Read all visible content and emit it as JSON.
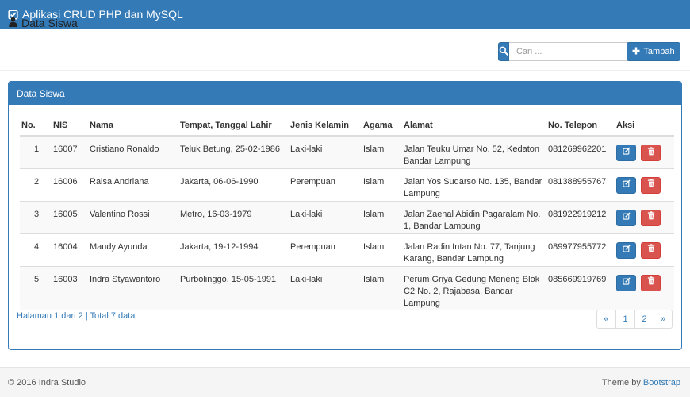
{
  "app": {
    "title": "Aplikasi CRUD PHP dan MySQL"
  },
  "header": {
    "title": "Data Siswa",
    "search_placeholder": "Cari ...",
    "add_label": "Tambah"
  },
  "panel": {
    "title": "Data Siswa"
  },
  "table": {
    "columns": [
      "No.",
      "NIS",
      "Nama",
      "Tempat, Tanggal Lahir",
      "Jenis Kelamin",
      "Agama",
      "Alamat",
      "No. Telepon",
      "Aksi"
    ],
    "rows": [
      {
        "no": "1",
        "nis": "16007",
        "nama": "Cristiano Ronaldo",
        "ttl": "Teluk Betung, 25-02-1986",
        "jk": "Laki-laki",
        "agama": "Islam",
        "alamat": "Jalan Teuku Umar No. 52, Kedaton Bandar Lampung",
        "telepon": "081269962201"
      },
      {
        "no": "2",
        "nis": "16006",
        "nama": "Raisa Andriana",
        "ttl": "Jakarta, 06-06-1990",
        "jk": "Perempuan",
        "agama": "Islam",
        "alamat": "Jalan Yos Sudarso No. 135, Bandar Lampung",
        "telepon": "081388955767"
      },
      {
        "no": "3",
        "nis": "16005",
        "nama": "Valentino Rossi",
        "ttl": "Metro, 16-03-1979",
        "jk": "Laki-laki",
        "agama": "Islam",
        "alamat": "Jalan Zaenal Abidin Pagaralam No. 1, Bandar Lampung",
        "telepon": "081922919212"
      },
      {
        "no": "4",
        "nis": "16004",
        "nama": "Maudy Ayunda",
        "ttl": "Jakarta, 19-12-1994",
        "jk": "Perempuan",
        "agama": "Islam",
        "alamat": "Jalan Radin Intan No. 77, Tanjung Karang, Bandar Lampung",
        "telepon": "089977955772"
      },
      {
        "no": "5",
        "nis": "16003",
        "nama": "Indra Styawantoro",
        "ttl": "Purbolinggo, 15-05-1991",
        "jk": "Laki-laki",
        "agama": "Islam",
        "alamat": "Perum Griya Gedung Meneng Blok C2 No. 2, Rajabasa, Bandar Lampung",
        "telepon": "085669919769"
      }
    ]
  },
  "pagination": {
    "info": "Halaman 1 dari 2 | Total 7 data",
    "prev": "«",
    "pages": [
      "1",
      "2"
    ],
    "next": "»"
  },
  "footer": {
    "copyright": "© 2016 Indra Studio",
    "theme_prefix": "Theme by",
    "theme_link": "Bootstrap"
  },
  "colors": {
    "primary": "#337ab7",
    "danger": "#d9534f",
    "footer_bg": "#f5f5f5"
  },
  "icons": {
    "brand": "check-square-icon",
    "title": "user-icon",
    "search": "search-icon",
    "add": "plus-icon",
    "edit": "edit-icon",
    "delete": "trash-icon"
  }
}
